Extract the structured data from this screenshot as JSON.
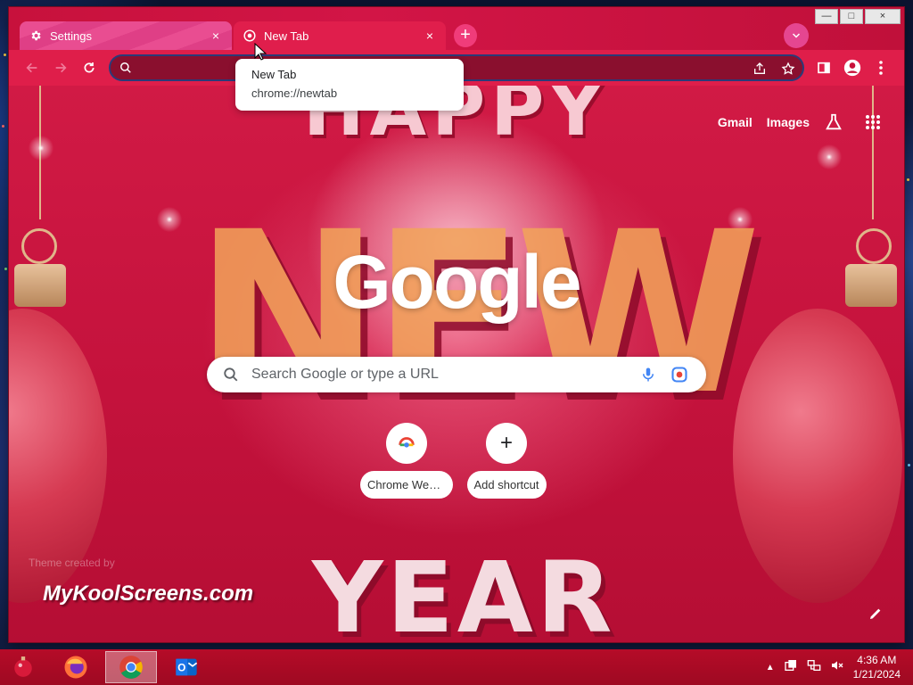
{
  "browser": {
    "tabs": [
      {
        "title": "Settings",
        "close": "×"
      },
      {
        "title": "New Tab",
        "close": "×"
      }
    ],
    "new_tab_symbol": "+",
    "window_controls": {
      "minimize": "—",
      "maximize": "□",
      "close": "×"
    },
    "omnibox": {
      "value": "",
      "placeholder": ""
    }
  },
  "tooltip": {
    "title": "New Tab",
    "url": "chrome://newtab"
  },
  "ntp": {
    "logo": "Google",
    "links": {
      "gmail": "Gmail",
      "images": "Images"
    },
    "search": {
      "placeholder": "Search Google or type a URL"
    },
    "shortcuts": [
      {
        "label": "Chrome Web ...",
        "icon": "chrome-web-store-icon"
      },
      {
        "label": "Add shortcut",
        "icon": "plus-icon",
        "symbol": "+"
      }
    ],
    "theme_credit": "Theme created by",
    "watermark": "MyKoolScreens.com",
    "background_text": {
      "top": "HAPPY",
      "middle": "NEW",
      "bottom": "YEAR"
    }
  },
  "taskbar": {
    "apps": [
      "ornament-start-icon",
      "firefox-icon",
      "chrome-icon",
      "outlook-icon"
    ],
    "time": "4:36 AM",
    "date": "1/21/2024",
    "tray_arrow": "▲"
  },
  "colors": {
    "frame": "#c8103a",
    "toolbar": "#df1e4a",
    "settings_tab": "#e94d91",
    "accent_pink": "#f03c7a"
  }
}
